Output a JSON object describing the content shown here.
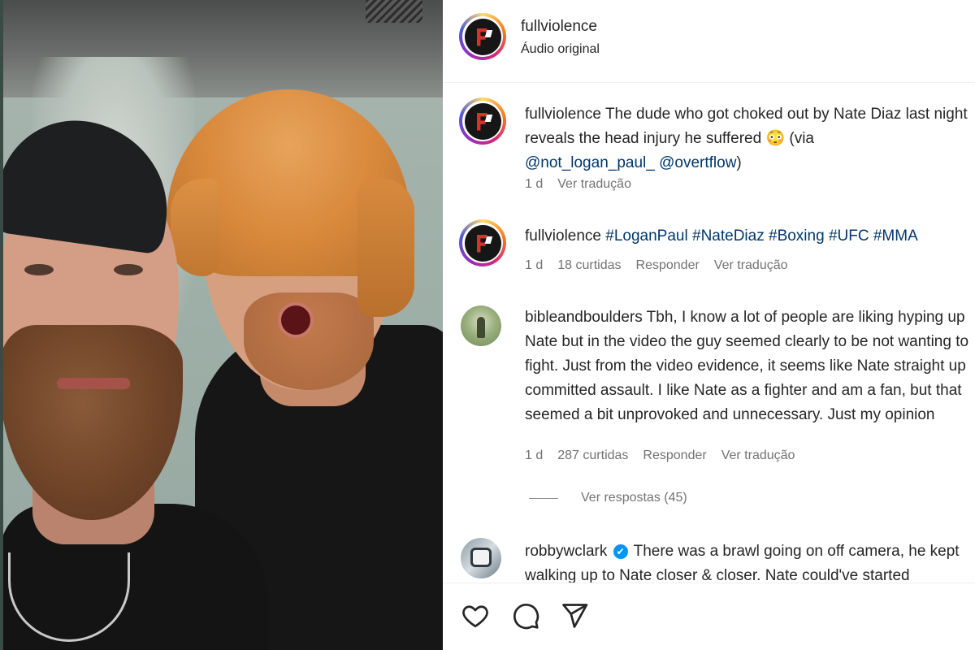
{
  "post": {
    "author": "fullviolence",
    "audio": "Áudio original"
  },
  "caption": {
    "user": "fullviolence",
    "text": "The dude who got choked out by Nate Diaz last night reveals the head injury he suffered 😳 (via",
    "mention1": "@not_logan_paul_",
    "mention2": "@overtflow",
    "close": ")",
    "time": "1 d",
    "translate": "Ver tradução"
  },
  "comments": [
    {
      "user": "fullviolence",
      "tags": [
        "#LoganPaul",
        "#NateDiaz",
        "#Boxing",
        "#UFC",
        "#MMA"
      ],
      "time": "1 d",
      "likes": "18 curtidas",
      "reply": "Responder",
      "translate": "Ver tradução"
    },
    {
      "user": "bibleandboulders",
      "text": "Tbh, I know a lot of people are liking hyping up Nate but in the video the guy seemed clearly to be not wanting to fight. Just from the video evidence, it seems like Nate straight up committed assault. I like Nate as a fighter and am a fan, but that seemed a bit unprovoked and unnecessary. Just my opinion",
      "time": "1 d",
      "likes": "287 curtidas",
      "reply": "Responder",
      "translate": "Ver tradução",
      "view_replies": "Ver respostas (45)"
    },
    {
      "user": "robbywclark",
      "verified": "✔",
      "text": "There was a brawl going on off camera, he kept walking up to Nate closer & closer. Nate could've started"
    }
  ],
  "icons": {
    "like": "heart-icon",
    "comment": "comment-icon",
    "share": "share-icon",
    "brand": "fullviolence-logo"
  },
  "colors": {
    "link": "#00376b",
    "muted": "#737373",
    "verified": "#0095f6"
  }
}
